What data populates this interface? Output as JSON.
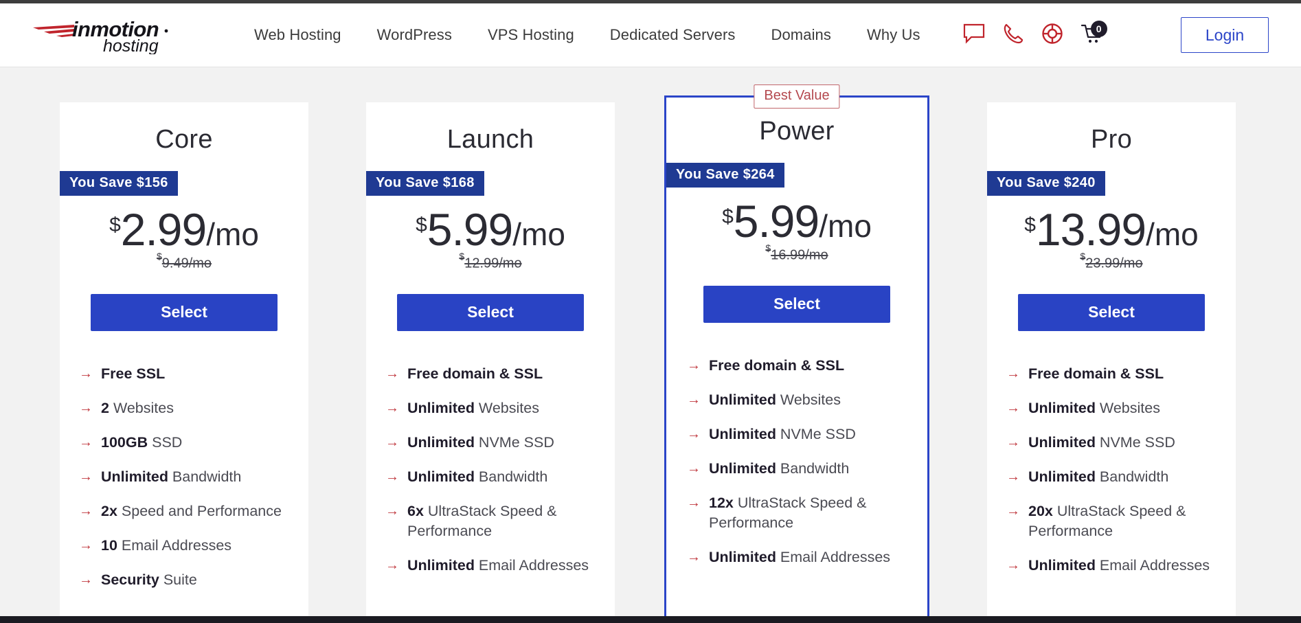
{
  "header": {
    "logo": {
      "name": "inmotion",
      "subtitle": "hosting",
      "swoosh_color": "#c0242c",
      "icon": "inmotion-hosting-logo"
    },
    "nav": [
      {
        "label": "Web Hosting",
        "icon": "nav-link"
      },
      {
        "label": "WordPress",
        "icon": "nav-link"
      },
      {
        "label": "VPS Hosting",
        "icon": "nav-link"
      },
      {
        "label": "Dedicated Servers",
        "icon": "nav-link"
      },
      {
        "label": "Domains",
        "icon": "nav-link"
      },
      {
        "label": "Why Us",
        "icon": "nav-link"
      }
    ],
    "util_icons": [
      {
        "name": "chat-icon",
        "color": "#c0242c"
      },
      {
        "name": "phone-icon",
        "color": "#c0242c"
      },
      {
        "name": "support-lifering-icon",
        "color": "#c0242c"
      },
      {
        "name": "cart-icon",
        "color": "#201c2b"
      }
    ],
    "cart_count": "0",
    "login_label": "Login",
    "login_color": "#2b45c8"
  },
  "pricing": {
    "best_value_label": "Best Value",
    "select_label": "Select",
    "accent_blue": "#2943c4",
    "badge_blue": "#1f3a93",
    "arrow_red": "#c0393f",
    "plans": [
      {
        "name": "Core",
        "save": "You Save $156",
        "currency": "$",
        "price": "2.99",
        "per": "/mo",
        "old_currency": "$",
        "old_price": "9.49/mo",
        "featured": false,
        "features": [
          {
            "bold": "Free SSL",
            "rest": ""
          },
          {
            "bold": "2",
            "rest": " Websites"
          },
          {
            "bold": "100GB",
            "rest": " SSD"
          },
          {
            "bold": "Unlimited",
            "rest": " Bandwidth"
          },
          {
            "bold": "2x",
            "rest": " Speed and Performance"
          },
          {
            "bold": "10",
            "rest": " Email Addresses"
          },
          {
            "bold": "Security",
            "rest": " Suite"
          }
        ]
      },
      {
        "name": "Launch",
        "save": "You Save $168",
        "currency": "$",
        "price": "5.99",
        "per": "/mo",
        "old_currency": "$",
        "old_price": "12.99/mo",
        "featured": false,
        "features": [
          {
            "bold": "Free domain & SSL",
            "rest": ""
          },
          {
            "bold": "Unlimited",
            "rest": " Websites"
          },
          {
            "bold": "Unlimited",
            "rest": " NVMe SSD"
          },
          {
            "bold": "Unlimited",
            "rest": " Bandwidth"
          },
          {
            "bold": "6x",
            "rest": " UltraStack Speed & Performance"
          },
          {
            "bold": "Unlimited",
            "rest": " Email Addresses"
          }
        ]
      },
      {
        "name": "Power",
        "save": "You Save $264",
        "currency": "$",
        "price": "5.99",
        "per": "/mo",
        "old_currency": "$",
        "old_price": "16.99/mo",
        "featured": true,
        "features": [
          {
            "bold": "Free domain & SSL",
            "rest": ""
          },
          {
            "bold": "Unlimited",
            "rest": " Websites"
          },
          {
            "bold": "Unlimited",
            "rest": " NVMe SSD"
          },
          {
            "bold": "Unlimited",
            "rest": " Bandwidth"
          },
          {
            "bold": "12x",
            "rest": " UltraStack Speed & Performance"
          },
          {
            "bold": "Unlimited",
            "rest": " Email Addresses"
          }
        ]
      },
      {
        "name": "Pro",
        "save": "You Save $240",
        "currency": "$",
        "price": "13.99",
        "per": "/mo",
        "old_currency": "$",
        "old_price": "23.99/mo",
        "featured": false,
        "features": [
          {
            "bold": "Free domain & SSL",
            "rest": ""
          },
          {
            "bold": "Unlimited",
            "rest": " Websites"
          },
          {
            "bold": "Unlimited",
            "rest": " NVMe SSD"
          },
          {
            "bold": "Unlimited",
            "rest": " Bandwidth"
          },
          {
            "bold": "20x",
            "rest": " UltraStack Speed & Performance"
          },
          {
            "bold": "Unlimited",
            "rest": " Email Addresses"
          }
        ]
      }
    ]
  }
}
